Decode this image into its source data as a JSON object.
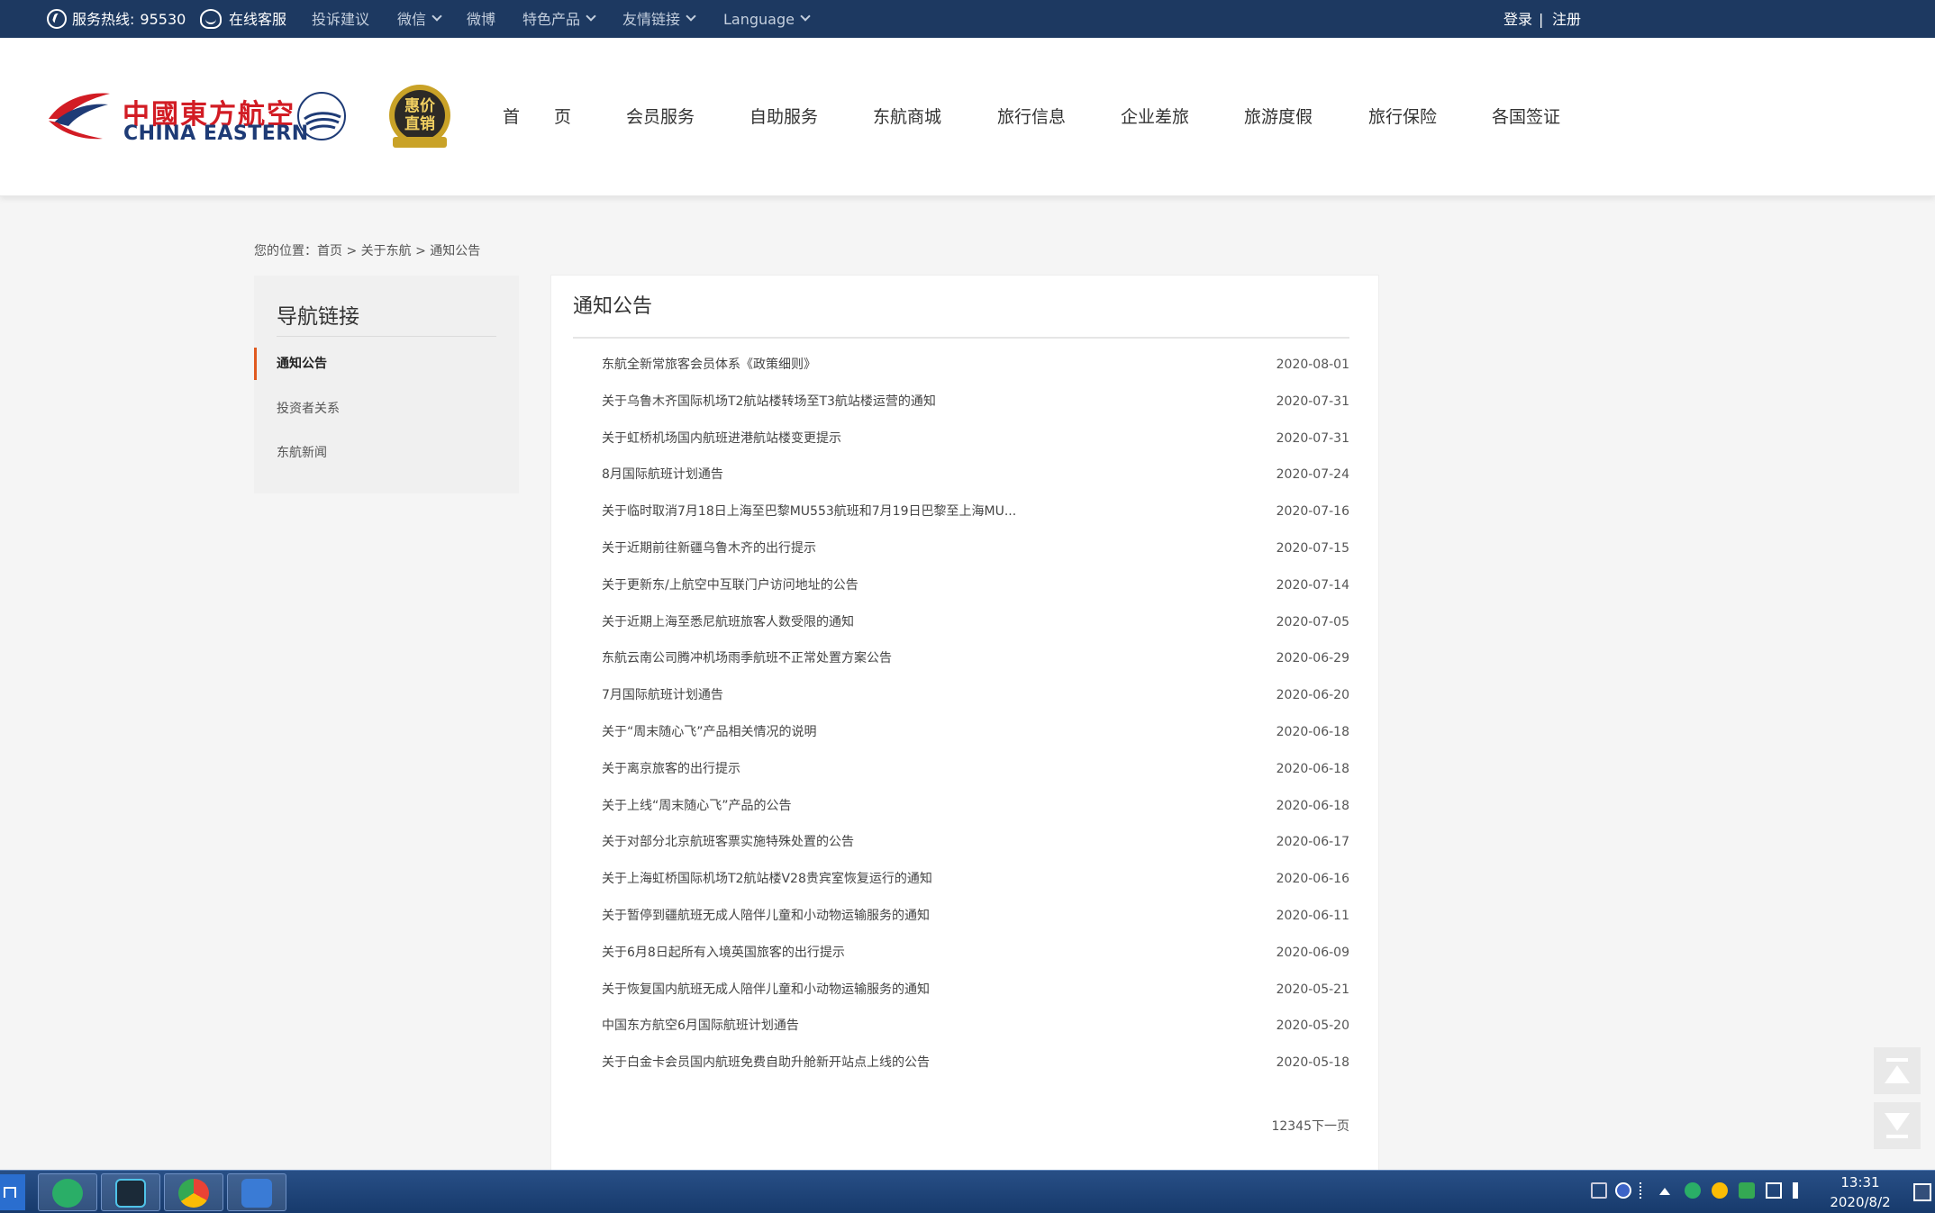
{
  "topbar": {
    "hotline_label": "服务热线:",
    "hotline_number": "95530",
    "online_service": "在线客服",
    "complaint": "投诉建议",
    "wechat": "微信",
    "weibo": "微博",
    "special_products": "特色产品",
    "friendly_links": "友情链接",
    "language": "Language",
    "login": "登录",
    "divider": "|",
    "register": "注册"
  },
  "header": {
    "logo_cn": "中國東方航空",
    "logo_en": "CHINA EASTERN",
    "badge_line1": "惠价",
    "badge_line2": "直销",
    "nav": [
      "首　　页",
      "会员服务",
      "自助服务",
      "东航商城",
      "旅行信息",
      "企业差旅",
      "旅游度假",
      "旅行保险",
      "各国签证"
    ]
  },
  "breadcrumb": "您的位置：首页 > 关于东航 > 通知公告",
  "sidebar": {
    "title": "导航链接",
    "items": [
      "通知公告",
      "投资者关系",
      "东航新闻"
    ]
  },
  "main": {
    "title": "通知公告",
    "rows": [
      {
        "title": "东航全新常旅客会员体系《政策细则》",
        "date": "2020-08-01"
      },
      {
        "title": "关于乌鲁木齐国际机场T2航站楼转场至T3航站楼运营的通知",
        "date": "2020-07-31"
      },
      {
        "title": "关于虹桥机场国内航班进港航站楼变更提示",
        "date": "2020-07-31"
      },
      {
        "title": "8月国际航班计划通告",
        "date": "2020-07-24"
      },
      {
        "title": "关于临时取消7月18日上海至巴黎MU553航班和7月19日巴黎至上海MU...",
        "date": "2020-07-16"
      },
      {
        "title": "关于近期前往新疆乌鲁木齐的出行提示",
        "date": "2020-07-15"
      },
      {
        "title": "关于更新东/上航空中互联门户访问地址的公告",
        "date": "2020-07-14"
      },
      {
        "title": "关于近期上海至悉尼航班旅客人数受限的通知",
        "date": "2020-07-05"
      },
      {
        "title": "东航云南公司腾冲机场雨季航班不正常处置方案公告",
        "date": "2020-06-29"
      },
      {
        "title": "7月国际航班计划通告",
        "date": "2020-06-20"
      },
      {
        "title": "关于“周末随心飞”产品相关情况的说明",
        "date": "2020-06-18"
      },
      {
        "title": "关于离京旅客的出行提示",
        "date": "2020-06-18"
      },
      {
        "title": "关于上线“周末随心飞”产品的公告",
        "date": "2020-06-18"
      },
      {
        "title": "关于对部分北京航班客票实施特殊处置的公告",
        "date": "2020-06-17"
      },
      {
        "title": "关于上海虹桥国际机场T2航站楼V28贵宾室恢复运行的通知",
        "date": "2020-06-16"
      },
      {
        "title": "关于暂停到疆航班无成人陪伴儿童和小动物运输服务的通知",
        "date": "2020-06-11"
      },
      {
        "title": "关于6月8日起所有入境英国旅客的出行提示",
        "date": "2020-06-09"
      },
      {
        "title": "关于恢复国内航班无成人陪伴儿童和小动物运输服务的通知",
        "date": "2020-05-21"
      },
      {
        "title": "中国东方航空6月国际航班计划通告",
        "date": "2020-05-20"
      },
      {
        "title": "关于白金卡会员国内航班免费自助升舱新开站点上线的公告",
        "date": "2020-05-18"
      }
    ],
    "pager": "12345下一页"
  },
  "taskbar": {
    "time": "13:31",
    "date": "2020/8/2"
  },
  "colors": {
    "topbar_bg": "#1d3961",
    "brand_red": "#d21c24",
    "brand_blue": "#1e3b76",
    "active_marker": "#e05a20"
  }
}
